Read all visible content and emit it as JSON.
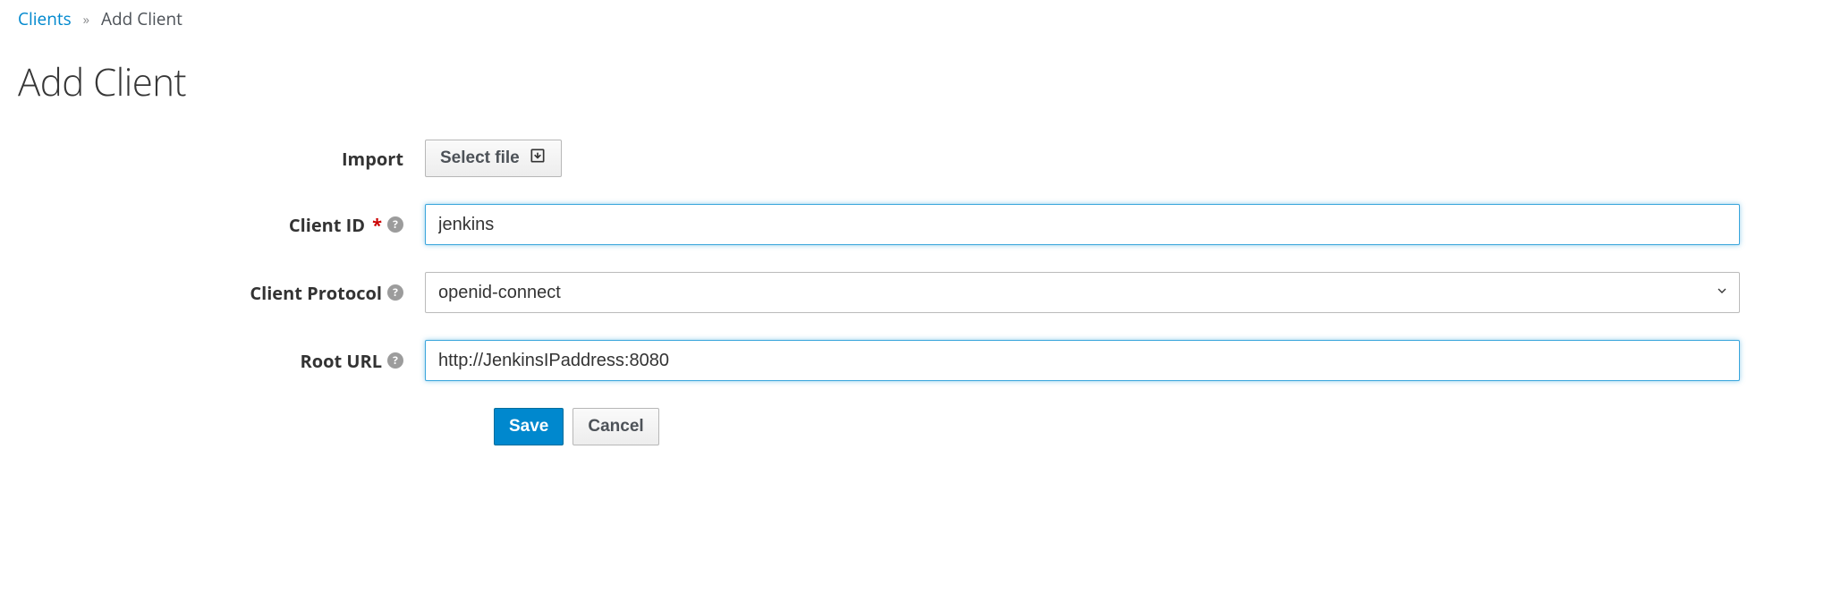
{
  "breadcrumb": {
    "parent": "Clients",
    "current": "Add Client"
  },
  "page_title": "Add Client",
  "form": {
    "import": {
      "label": "Import",
      "button_label": "Select file"
    },
    "client_id": {
      "label": "Client ID",
      "required_mark": "*",
      "help": "?",
      "value": "jenkins"
    },
    "client_protocol": {
      "label": "Client Protocol",
      "help": "?",
      "value": "openid-connect"
    },
    "root_url": {
      "label": "Root URL",
      "help": "?",
      "value": "http://JenkinsIPaddress:8080"
    }
  },
  "actions": {
    "save": "Save",
    "cancel": "Cancel"
  },
  "colors": {
    "link": "#0088ce",
    "primary": "#0088ce",
    "required": "#cc0000",
    "focus_ring": "#39a5dc"
  }
}
